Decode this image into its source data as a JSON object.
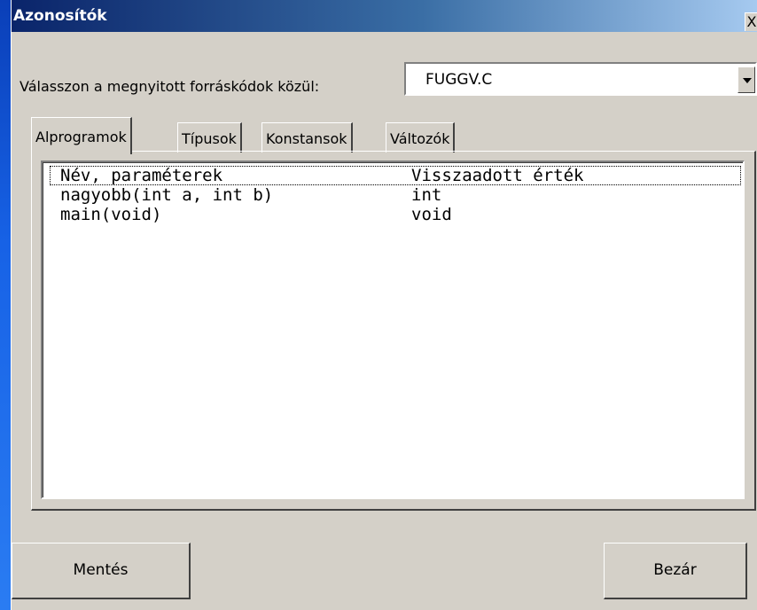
{
  "window": {
    "title": "Azonosítók",
    "close_glyph": "X"
  },
  "source": {
    "label": "Válasszon a megnyitott forráskódok közül:",
    "selected": "FUGGV.C"
  },
  "tabs": [
    {
      "label": "Alprogramok",
      "active": true
    },
    {
      "label": "Típusok",
      "active": false
    },
    {
      "label": "Konstansok",
      "active": false
    },
    {
      "label": "Változók",
      "active": false
    }
  ],
  "list": {
    "columns": [
      "Név, paraméterek",
      "Visszaadott érték"
    ],
    "rows": [
      [
        "nagyobb(int a, int b)",
        "int"
      ],
      [
        "main(void)",
        "void"
      ]
    ]
  },
  "buttons": {
    "save": "Mentés",
    "close": "Bezár"
  },
  "colors": {
    "titlebar_start": "#0a246a",
    "titlebar_end": "#a6caf0",
    "dialog_bg": "#d4d0c8"
  }
}
